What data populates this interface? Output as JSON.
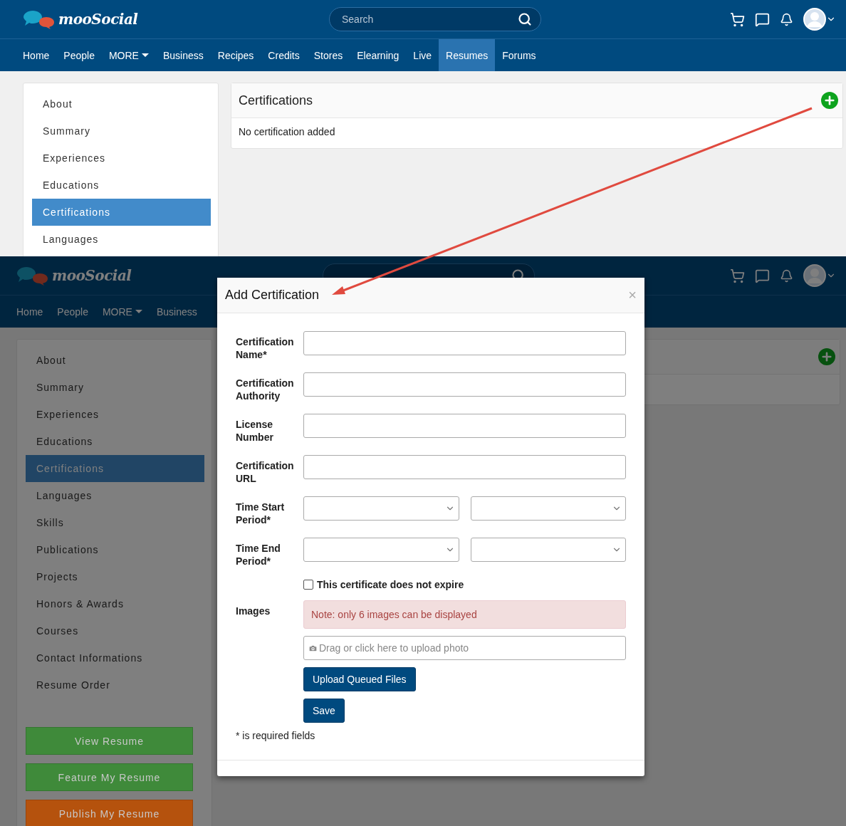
{
  "top_screen": {
    "logo": "mooSocial",
    "search": {
      "placeholder": "Search"
    },
    "nav": [
      {
        "label": "Home",
        "selected": false,
        "caret": false
      },
      {
        "label": "People",
        "selected": false,
        "caret": false
      },
      {
        "label": "MORE",
        "selected": false,
        "caret": true
      },
      {
        "label": "Business",
        "selected": false,
        "caret": false
      },
      {
        "label": "Recipes",
        "selected": false,
        "caret": false
      },
      {
        "label": "Credits",
        "selected": false,
        "caret": false
      },
      {
        "label": "Stores",
        "selected": false,
        "caret": false
      },
      {
        "label": "Elearning",
        "selected": false,
        "caret": false
      },
      {
        "label": "Live",
        "selected": false,
        "caret": false
      },
      {
        "label": "Resumes",
        "selected": true,
        "caret": false
      },
      {
        "label": "Forums",
        "selected": false,
        "caret": false
      }
    ],
    "sidebar": {
      "items": [
        {
          "label": "About",
          "selected": false
        },
        {
          "label": "Summary",
          "selected": false
        },
        {
          "label": "Experiences",
          "selected": false
        },
        {
          "label": "Educations",
          "selected": false
        },
        {
          "label": "Certifications",
          "selected": true
        },
        {
          "label": "Languages",
          "selected": false
        }
      ]
    },
    "card": {
      "title": "Certifications",
      "empty_text": "No certification added"
    }
  },
  "bottom_screen": {
    "logo": "mooSocial",
    "nav": [
      {
        "label": "Home",
        "selected": false,
        "caret": false
      },
      {
        "label": "People",
        "selected": false,
        "caret": false
      },
      {
        "label": "MORE",
        "selected": false,
        "caret": true
      },
      {
        "label": "Business",
        "selected": false,
        "caret": false
      }
    ],
    "sidebar": {
      "items": [
        {
          "label": "About",
          "selected": false
        },
        {
          "label": "Summary",
          "selected": false
        },
        {
          "label": "Experiences",
          "selected": false
        },
        {
          "label": "Educations",
          "selected": false
        },
        {
          "label": "Certifications",
          "selected": true
        },
        {
          "label": "Languages",
          "selected": false
        },
        {
          "label": "Skills",
          "selected": false
        },
        {
          "label": "Publications",
          "selected": false
        },
        {
          "label": "Projects",
          "selected": false
        },
        {
          "label": "Honors & Awards",
          "selected": false
        },
        {
          "label": "Courses",
          "selected": false
        },
        {
          "label": "Contact Informations",
          "selected": false
        },
        {
          "label": "Resume Order",
          "selected": false
        }
      ],
      "buttons": [
        {
          "label": "View Resume",
          "color": "#3f8a3a"
        },
        {
          "label": "Feature My Resume",
          "color": "#3f8a3a"
        },
        {
          "label": "Publish My Resume",
          "color": "#b5520d"
        }
      ]
    }
  },
  "modal": {
    "title": "Add Certification",
    "close": "×",
    "fields": [
      {
        "kind": "text",
        "label": "Certification Name*"
      },
      {
        "kind": "text",
        "label": "Certification Authority"
      },
      {
        "kind": "text",
        "label": "License Number"
      },
      {
        "kind": "text",
        "label": "Certification URL"
      },
      {
        "kind": "select_pair",
        "label": "Time Start Period*"
      },
      {
        "kind": "select_pair",
        "label": "Time End Period*"
      }
    ],
    "no_expiry": {
      "label": "This certificate does not expire",
      "checked": false
    },
    "images": {
      "label": "Images",
      "note": "Note: only 6 images can be displayed",
      "upload_placeholder": "Drag or click here to upload photo"
    },
    "buttons": [
      "Upload Queued Files",
      "Save"
    ],
    "footnote": "* is required fields"
  }
}
